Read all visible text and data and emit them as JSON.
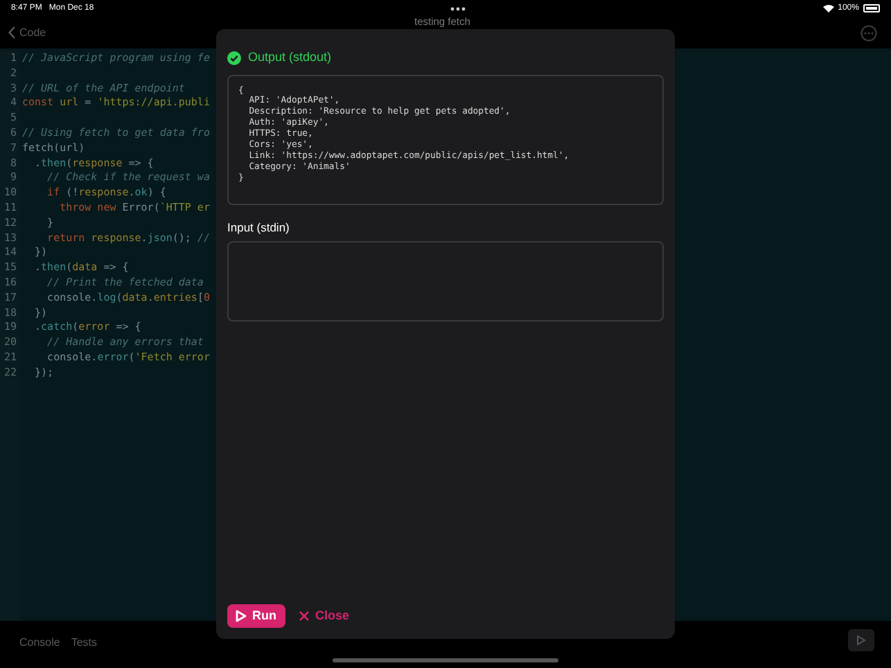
{
  "status_bar": {
    "time": "8:47 PM",
    "date": "Mon Dec 18",
    "battery": "100%"
  },
  "nav": {
    "back_label": "Code",
    "title": "testing fetch"
  },
  "editor": {
    "lines": [
      {
        "number": "1",
        "tokens": [
          {
            "kind": "comment",
            "text": "// JavaScript program using fe"
          }
        ]
      },
      {
        "number": "2"
      },
      {
        "number": "3",
        "tokens": [
          {
            "kind": "comment",
            "text": "// URL of the API endpoint"
          }
        ]
      },
      {
        "number": "4",
        "tokens": [
          {
            "kind": "keyword",
            "text": "const "
          },
          {
            "kind": "variable",
            "text": "url"
          },
          {
            "kind": "plain",
            "text": " = "
          },
          {
            "kind": "string",
            "text": "'https://api.publi"
          }
        ]
      },
      {
        "number": "5"
      },
      {
        "number": "6",
        "tokens": [
          {
            "kind": "comment",
            "text": "// Using fetch to get data fro"
          }
        ]
      },
      {
        "number": "7",
        "tokens": [
          {
            "kind": "plain",
            "text": "fetch(url)"
          }
        ]
      },
      {
        "number": "8",
        "tokens": [
          {
            "kind": "plain",
            "text": "  ."
          },
          {
            "kind": "method",
            "text": "then"
          },
          {
            "kind": "plain",
            "text": "("
          },
          {
            "kind": "variable",
            "text": "response"
          },
          {
            "kind": "plain",
            "text": " => {"
          }
        ]
      },
      {
        "number": "9",
        "tokens": [
          {
            "kind": "comment",
            "text": "    // Check if the request wa"
          }
        ]
      },
      {
        "number": "10",
        "tokens": [
          {
            "kind": "keyword",
            "text": "    if "
          },
          {
            "kind": "plain",
            "text": "(!"
          },
          {
            "kind": "variable",
            "text": "response"
          },
          {
            "kind": "plain",
            "text": "."
          },
          {
            "kind": "method",
            "text": "ok"
          },
          {
            "kind": "plain",
            "text": ") {"
          }
        ]
      },
      {
        "number": "11",
        "tokens": [
          {
            "kind": "keyword",
            "text": "      throw new "
          },
          {
            "kind": "plain",
            "text": "Error("
          },
          {
            "kind": "string",
            "text": "`HTTP er"
          }
        ]
      },
      {
        "number": "12",
        "tokens": [
          {
            "kind": "plain",
            "text": "    }"
          }
        ]
      },
      {
        "number": "13",
        "tokens": [
          {
            "kind": "keyword",
            "text": "    return "
          },
          {
            "kind": "variable",
            "text": "response"
          },
          {
            "kind": "plain",
            "text": "."
          },
          {
            "kind": "method",
            "text": "json"
          },
          {
            "kind": "plain",
            "text": "(); "
          },
          {
            "kind": "comment",
            "text": "//"
          }
        ]
      },
      {
        "number": "14",
        "tokens": [
          {
            "kind": "plain",
            "text": "  })"
          }
        ]
      },
      {
        "number": "15",
        "tokens": [
          {
            "kind": "plain",
            "text": "  ."
          },
          {
            "kind": "method",
            "text": "then"
          },
          {
            "kind": "plain",
            "text": "("
          },
          {
            "kind": "variable",
            "text": "data"
          },
          {
            "kind": "plain",
            "text": " => {"
          }
        ]
      },
      {
        "number": "16",
        "tokens": [
          {
            "kind": "comment",
            "text": "    // Print the fetched data"
          }
        ]
      },
      {
        "number": "17",
        "tokens": [
          {
            "kind": "plain",
            "text": "    console."
          },
          {
            "kind": "method",
            "text": "log"
          },
          {
            "kind": "plain",
            "text": "("
          },
          {
            "kind": "variable",
            "text": "data"
          },
          {
            "kind": "plain",
            "text": "."
          },
          {
            "kind": "variable",
            "text": "entries"
          },
          {
            "kind": "plain",
            "text": "["
          },
          {
            "kind": "keyword",
            "text": "0"
          }
        ]
      },
      {
        "number": "18",
        "tokens": [
          {
            "kind": "plain",
            "text": "  })"
          }
        ]
      },
      {
        "number": "19",
        "tokens": [
          {
            "kind": "plain",
            "text": "  ."
          },
          {
            "kind": "method",
            "text": "catch"
          },
          {
            "kind": "plain",
            "text": "("
          },
          {
            "kind": "variable",
            "text": "error"
          },
          {
            "kind": "plain",
            "text": " => {"
          }
        ]
      },
      {
        "number": "20",
        "tokens": [
          {
            "kind": "comment",
            "text": "    // Handle any errors that"
          }
        ]
      },
      {
        "number": "21",
        "tokens": [
          {
            "kind": "plain",
            "text": "    console."
          },
          {
            "kind": "method",
            "text": "error"
          },
          {
            "kind": "plain",
            "text": "("
          },
          {
            "kind": "string",
            "text": "'Fetch error"
          }
        ]
      },
      {
        "number": "22",
        "tokens": [
          {
            "kind": "plain",
            "text": "  });"
          }
        ]
      }
    ]
  },
  "bottom_tabs": [
    {
      "label": "Console"
    },
    {
      "label": "Tests"
    }
  ],
  "modal": {
    "output": {
      "title": "Output (stdout)",
      "text": "{\n  API: 'AdoptAPet',\n  Description: 'Resource to help get pets adopted',\n  Auth: 'apiKey',\n  HTTPS: true,\n  Cors: 'yes',\n  Link: 'https://www.adoptapet.com/public/apis/pet_list.html',\n  Category: 'Animals'\n}"
    },
    "input": {
      "label": "Input (stdin)"
    },
    "buttons": [
      {
        "kind": "run",
        "label": "Run"
      },
      {
        "kind": "close",
        "label": "Close"
      }
    ]
  }
}
